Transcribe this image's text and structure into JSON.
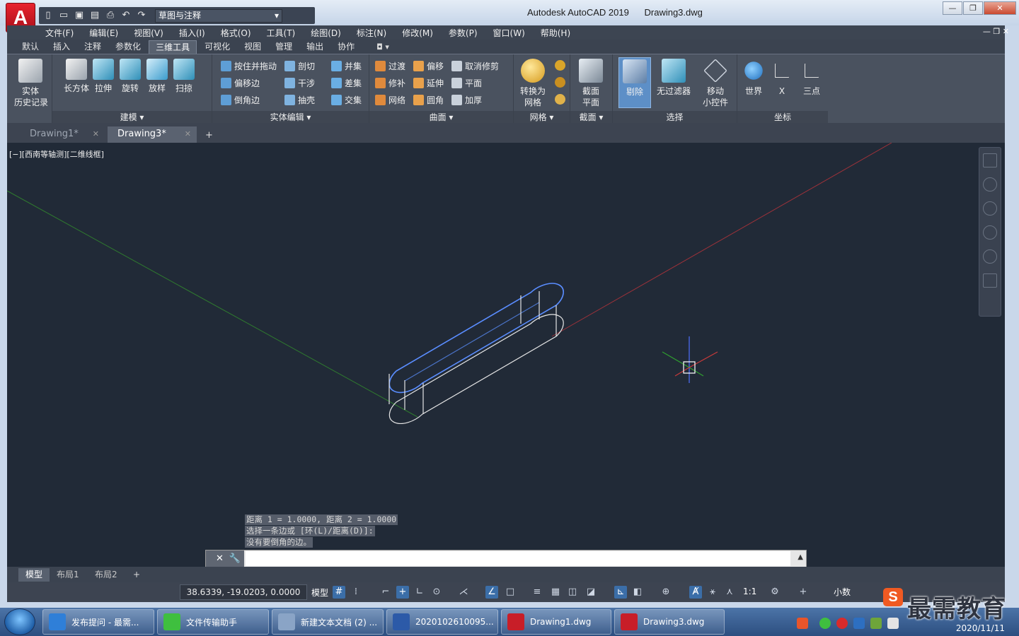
{
  "window": {
    "app_title": "Autodesk AutoCAD 2019",
    "doc_title": "Drawing3.dwg",
    "logo_letter": "A",
    "workspace": "草图与注释"
  },
  "menu": [
    "文件(F)",
    "编辑(E)",
    "视图(V)",
    "插入(I)",
    "格式(O)",
    "工具(T)",
    "绘图(D)",
    "标注(N)",
    "修改(M)",
    "参数(P)",
    "窗口(W)",
    "帮助(H)"
  ],
  "ribbon_tabs": [
    {
      "label": "默认",
      "active": false
    },
    {
      "label": "插入",
      "active": false
    },
    {
      "label": "注释",
      "active": false
    },
    {
      "label": "参数化",
      "active": false
    },
    {
      "label": "三维工具",
      "active": true
    },
    {
      "label": "可视化",
      "active": false
    },
    {
      "label": "视图",
      "active": false
    },
    {
      "label": "管理",
      "active": false
    },
    {
      "label": "输出",
      "active": false
    },
    {
      "label": "协作",
      "active": false
    }
  ],
  "ribbon": {
    "history": {
      "label": "实体\n历史记录"
    },
    "modeling": {
      "title": "建模",
      "buttons": [
        "长方体",
        "拉伸",
        "旋转",
        "放样",
        "扫掠"
      ]
    },
    "solid_edit": {
      "title": "实体编辑",
      "col1": [
        "按住并拖动",
        "偏移边",
        "倒角边"
      ],
      "col2": [
        "剖切",
        "干涉",
        "抽壳"
      ],
      "col3": [
        "并集",
        "差集",
        "交集"
      ]
    },
    "surface": {
      "title": "曲面",
      "col1": [
        "过渡",
        "修补",
        "网络"
      ],
      "col2": [
        "偏移",
        "延伸",
        "圆角"
      ],
      "col3": [
        "取消修剪",
        "平面",
        "加厚"
      ]
    },
    "mesh": {
      "title": "网格",
      "convert": "转换为\n网格"
    },
    "section": {
      "title": "截面",
      "plane": "截面\n平面"
    },
    "select": {
      "title": "选择",
      "cull": "剔除",
      "nofilter": "无过滤器",
      "gizmo": "移动\n小控件"
    },
    "ucs": {
      "title": "坐标",
      "world": "世界",
      "x": "X",
      "three_point": "三点"
    }
  },
  "file_tabs": [
    {
      "label": "Drawing1*",
      "active": false
    },
    {
      "label": "Drawing3*",
      "active": true
    }
  ],
  "viewport": {
    "label": "[−][西南等轴测][二维线框]"
  },
  "command": {
    "history": [
      "距离 1 = 1.0000, 距离 2 = 1.0000",
      "选择一条边或 [环(L)/距离(D)]:",
      "没有要倒角的边。"
    ],
    "input_value": ""
  },
  "layout_tabs": [
    {
      "label": "模型",
      "active": true
    },
    {
      "label": "布局1",
      "active": false
    },
    {
      "label": "布局2",
      "active": false
    }
  ],
  "status": {
    "coords": "38.6339, -19.0203, 0.0000",
    "model": "模型",
    "scale": "1:1",
    "units": "小数"
  },
  "watermark": {
    "logo": "S",
    "text": "最需教育"
  },
  "taskbar": [
    {
      "label": "发布提问 - 最需...",
      "color": "#2f7fd8"
    },
    {
      "label": "文件传输助手",
      "color": "#3fbf3f"
    },
    {
      "label": "新建文本文档 (2) ...",
      "color": "#8aa4c6"
    },
    {
      "label": "2020102610095...",
      "color": "#2c5aa8"
    },
    {
      "label": "Drawing1.dwg",
      "color": "#c81e28"
    },
    {
      "label": "Drawing3.dwg",
      "color": "#c81e28"
    }
  ],
  "clock": {
    "date": "2020/11/11"
  },
  "colors": {
    "viewport_bg": "#212a37",
    "x_axis": "#a0323a",
    "y_axis": "#2f7a2f",
    "model_edges": "#e6e6e6",
    "selected_edge": "#5a8dff"
  }
}
